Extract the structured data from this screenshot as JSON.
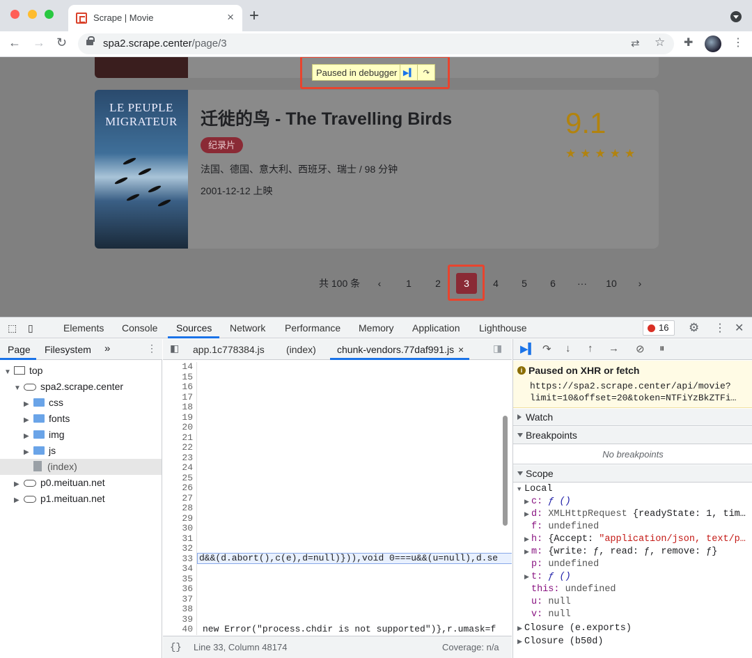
{
  "browser": {
    "tab_title": "Scrape | Movie",
    "tab_close": "×",
    "new_tab": "+",
    "url_host": "spa2.scrape.center",
    "url_path": "/page/3"
  },
  "page": {
    "debugger_pill": "Paused in debugger",
    "movie": {
      "poster_title_1": "LE PEUPLE",
      "poster_title_2": "MIGRATEUR",
      "title": "迁徙的鸟 - The Travelling Birds",
      "tag": "纪录片",
      "info": "法国、德国、意大利、西班牙、瑞士 / 98 分钟",
      "date": "2001-12-12 上映",
      "score": "9.1",
      "stars": "★★★★★"
    },
    "pager": {
      "total": "共 100 条",
      "prev": "‹",
      "pages": [
        "1",
        "2",
        "3",
        "4",
        "5",
        "6",
        "···",
        "10"
      ],
      "active": "3",
      "next": "›"
    }
  },
  "devtools": {
    "tabs": [
      "Elements",
      "Console",
      "Sources",
      "Network",
      "Performance",
      "Memory",
      "Application",
      "Lighthouse"
    ],
    "error_count": "16",
    "nav_tabs": [
      "Page",
      "Filesystem",
      "»"
    ],
    "tree": {
      "top": "top",
      "host": "spa2.scrape.center",
      "folders": [
        "css",
        "fonts",
        "img",
        "js"
      ],
      "index": "(index)",
      "other_hosts": [
        "p0.meituan.net",
        "p1.meituan.net"
      ]
    },
    "editor": {
      "tabs": [
        "app.1c778384.js",
        "(index)",
        "chunk-vendors.77daf991.js"
      ],
      "tab_close": "×",
      "line_numbers": [
        "14",
        "15",
        "16",
        "17",
        "18",
        "19",
        "20",
        "21",
        "22",
        "23",
        "24",
        "25",
        "26",
        "27",
        "28",
        "29",
        "30",
        "31",
        "32",
        "33",
        "34",
        "35",
        "36",
        "37",
        "38",
        "39",
        "40"
      ],
      "line33": "d&&(d.abort(),c(e),d=null)})),void 0===u&&(u=null),d.se",
      "line40": "new Error(\"process.chdir is not supported\")},r.umask=f",
      "status_brace": "{}",
      "status_pos": "Line 33, Column 48174",
      "status_cov": "Coverage: n/a"
    },
    "debugger": {
      "paused_title": "Paused on XHR or fetch",
      "paused_url_1": "https://spa2.scrape.center/api/movie?",
      "paused_url_2": "limit=10&offset=20&token=NTFiYzBkZTFi…",
      "watch": "Watch",
      "breakpoints": "Breakpoints",
      "no_breakpoints": "No breakpoints",
      "scope": "Scope",
      "local": "Local",
      "vars": {
        "c_key": "c:",
        "c_val": "ƒ ()",
        "d_key": "d:",
        "d_val": "XMLHttpRequest",
        "d_rest": "{readyState: 1, tim…",
        "f_key": "f:",
        "f_val": "undefined",
        "h_key": "h:",
        "h_open": "{Accept:",
        "h_val": "\"application/json, text/p…",
        "m_key": "m:",
        "m_val": "{write: ƒ, read: ƒ, remove: ƒ}",
        "p_key": "p:",
        "p_val": "undefined",
        "t_key": "t:",
        "t_val": "ƒ ()",
        "this_key": "this:",
        "this_val": "undefined",
        "u_key": "u:",
        "u_val": "null",
        "v_key": "v:",
        "v_val": "null"
      },
      "closure1": "Closure (e.exports)",
      "closure2": "Closure (b50d)"
    }
  }
}
